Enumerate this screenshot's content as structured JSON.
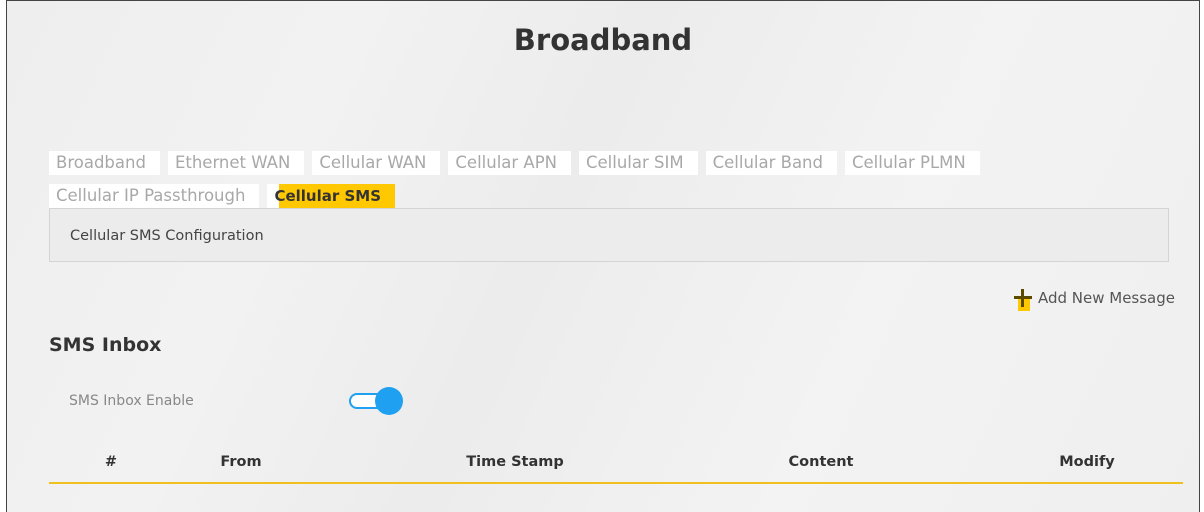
{
  "page_title": "Broadband",
  "tabs": [
    {
      "label": "Broadband",
      "active": false
    },
    {
      "label": "Ethernet WAN",
      "active": false
    },
    {
      "label": "Cellular WAN",
      "active": false
    },
    {
      "label": "Cellular APN",
      "active": false
    },
    {
      "label": "Cellular SIM",
      "active": false
    },
    {
      "label": "Cellular Band",
      "active": false
    },
    {
      "label": "Cellular PLMN",
      "active": false
    },
    {
      "label": "Cellular IP Passthrough",
      "active": false
    },
    {
      "label": "Cellular SMS",
      "active": true
    }
  ],
  "config_bar": {
    "label": "Cellular SMS Configuration"
  },
  "add_message": {
    "label": "Add New Message",
    "icon": "plus-icon"
  },
  "inbox": {
    "title": "SMS Inbox",
    "enable_label": "SMS Inbox Enable",
    "enabled": true
  },
  "table": {
    "columns": [
      "#",
      "From",
      "Time Stamp",
      "Content",
      "Modify"
    ]
  },
  "colors": {
    "accent": "#ffc800",
    "toggle": "#1fa0f0"
  }
}
